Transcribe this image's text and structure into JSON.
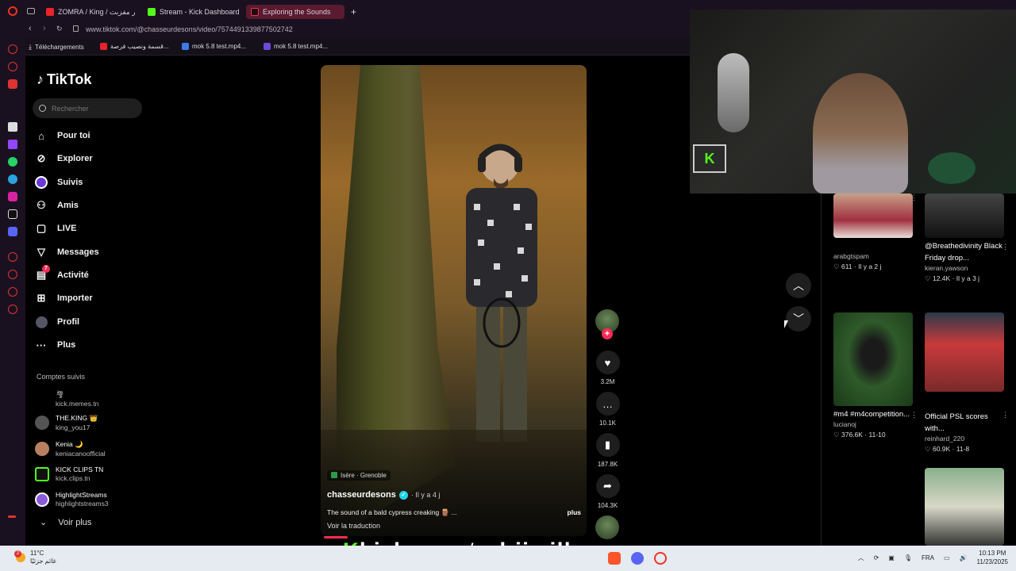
{
  "browser": {
    "tabs": [
      {
        "label": "ZOMRA / King / عطر مفزبت",
        "color": "#e8232a"
      },
      {
        "label": "Stream - Kick Dashboard",
        "color": "#53fc18"
      },
      {
        "label": "Exploring the Sounds",
        "color": "#fe2c55"
      }
    ],
    "new_tab": "+",
    "url": "www.tiktok.com/@chasseurdesons/video/7574491339877502742",
    "bookmarks": [
      {
        "label": "Téléchargements"
      },
      {
        "label": "قسمة ونصيب فرصة..."
      },
      {
        "label": "mok 5.8 test.mp4..."
      },
      {
        "label": "mok 5.8 test.mp4..."
      }
    ]
  },
  "tiktok": {
    "logo": "TikTok",
    "search_placeholder": "Rechercher",
    "nav": [
      {
        "label": "Pour toi",
        "icon": "home-icon"
      },
      {
        "label": "Explorer",
        "icon": "compass-icon"
      },
      {
        "label": "Suivis",
        "icon": "following-icon"
      },
      {
        "label": "Amis",
        "icon": "friends-icon"
      },
      {
        "label": "LIVE",
        "icon": "live-icon"
      },
      {
        "label": "Messages",
        "icon": "messages-icon"
      },
      {
        "label": "Activité",
        "icon": "activity-icon",
        "badge": "7"
      },
      {
        "label": "Importer",
        "icon": "upload-icon"
      },
      {
        "label": "Profil",
        "icon": "profile-icon"
      },
      {
        "label": "Plus",
        "icon": "more-icon"
      }
    ],
    "followed_title": "Comptes suivis",
    "followed": [
      {
        "name": "🌪",
        "handle": "kick.memes.tn",
        "color": "#000"
      },
      {
        "name": "THE.KING 👑",
        "handle": "king_you17",
        "color": "#555"
      },
      {
        "name": "Kenia 🌙",
        "handle": "keniacanoofficial",
        "color": "#b88060"
      },
      {
        "name": "KICK CLIPS TN",
        "handle": "kick.clips.tn",
        "color": "#53fc18"
      },
      {
        "name": "HighlightStreams",
        "handle": "highlightstreams3",
        "color": "#8a5ad8"
      }
    ],
    "see_more": "Voir plus"
  },
  "video": {
    "location": "Isère · Grenoble",
    "author": "chasseurdesons",
    "posted": "· Il y a 4 j",
    "description": "The sound of a bald cypress creaking 🪵 ...",
    "more": "plus",
    "translate": "Voir la traduction",
    "likes": "3.2M",
    "comments": "10.1K",
    "saves": "187.8K",
    "shares": "104.3K",
    "progress_percent": 9
  },
  "grid": [
    {
      "title": "",
      "author": "arabgtspam",
      "likes": "611",
      "time": "Il y a 2 j",
      "color": "#a03040"
    },
    {
      "title": "@Breathedivinity Black Friday drop...",
      "author": "kieran.yawson",
      "likes": "12.4K",
      "time": "Il y a 3 j",
      "color": "#222"
    },
    {
      "title": "#m4 #m4competition...",
      "author": "lucianoj",
      "likes": "376.6K",
      "time": "11-10",
      "color": "#2a4a22"
    },
    {
      "title": "Official PSL scores with...",
      "author": "reinhard_220",
      "likes": "60.9K",
      "time": "11-8",
      "color": "#8a2a2a"
    },
    {
      "title": "",
      "author": "",
      "likes": "",
      "time": "",
      "color": "#4a6a4a"
    }
  ],
  "overlay": {
    "kick_banner_k": "K",
    "kick_banner_text": "kick.com/rebiiwillson"
  },
  "taskbar": {
    "temp": "11°C",
    "weather_text": "غائم جزئيًا",
    "weather_badge": "2",
    "lang": "FRA",
    "time": "10:13 PM",
    "date": "11/23/2025"
  }
}
